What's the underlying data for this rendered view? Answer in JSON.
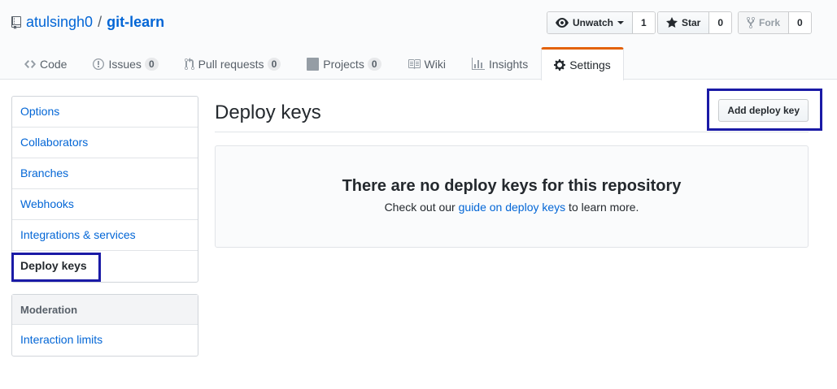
{
  "repo": {
    "owner": "atulsingh0",
    "separator": "/",
    "name": "git-learn"
  },
  "actions": {
    "watch": {
      "label": "Unwatch",
      "count": "1"
    },
    "star": {
      "label": "Star",
      "count": "0"
    },
    "fork": {
      "label": "Fork",
      "count": "0"
    }
  },
  "tabs": [
    {
      "label": "Code"
    },
    {
      "label": "Issues",
      "count": "0"
    },
    {
      "label": "Pull requests",
      "count": "0"
    },
    {
      "label": "Projects",
      "count": "0"
    },
    {
      "label": "Wiki"
    },
    {
      "label": "Insights"
    },
    {
      "label": "Settings"
    }
  ],
  "settings_menu": {
    "items": [
      "Options",
      "Collaborators",
      "Branches",
      "Webhooks",
      "Integrations & services",
      "Deploy keys"
    ],
    "selected": "Deploy keys"
  },
  "moderation_menu": {
    "heading": "Moderation",
    "items": [
      "Interaction limits"
    ]
  },
  "main": {
    "title": "Deploy keys",
    "add_button": "Add deploy key",
    "blank_title": "There are no deploy keys for this repository",
    "blank_prefix": "Check out our ",
    "blank_link": "guide on deploy keys",
    "blank_suffix": " to learn more."
  },
  "colors": {
    "link": "#0366d6",
    "selected_tab_accent": "#e36209",
    "annotation_box": "#1a1aa6"
  }
}
